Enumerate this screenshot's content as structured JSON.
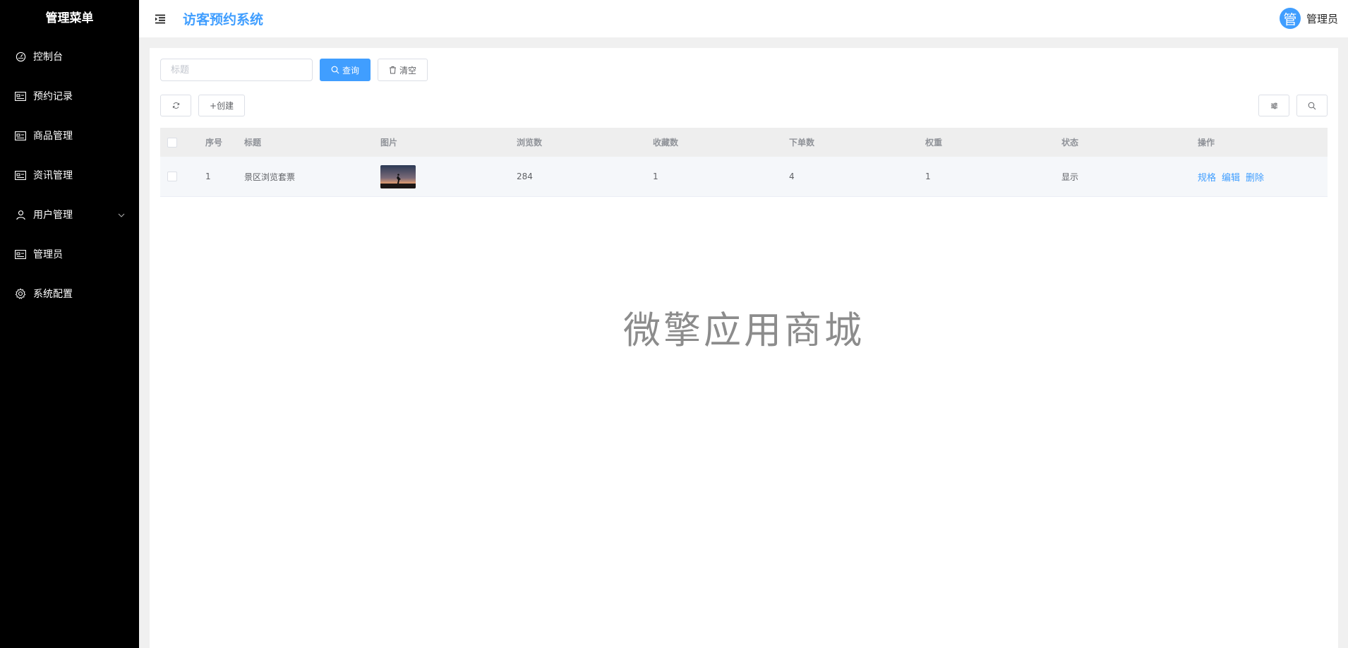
{
  "sidebar": {
    "title": "管理菜单",
    "items": [
      {
        "label": "控制台",
        "icon": "dashboard-icon"
      },
      {
        "label": "预约记录",
        "icon": "card-icon"
      },
      {
        "label": "商品管理",
        "icon": "card-icon"
      },
      {
        "label": "资讯管理",
        "icon": "card-icon"
      },
      {
        "label": "用户管理",
        "icon": "user-icon",
        "expandable": true
      },
      {
        "label": "管理员",
        "icon": "card-icon"
      },
      {
        "label": "系统配置",
        "icon": "gear-icon"
      }
    ]
  },
  "header": {
    "title": "访客预约系统",
    "avatar_text": "管",
    "user_name": "管理员"
  },
  "search": {
    "placeholder": "标题",
    "query_label": "查询",
    "clear_label": "清空"
  },
  "toolbar": {
    "create_label": "+创建"
  },
  "table": {
    "headers": {
      "idx": "序号",
      "title": "标题",
      "image": "图片",
      "views": "浏览数",
      "favs": "收藏数",
      "orders": "下单数",
      "weight": "权重",
      "status": "状态",
      "ops": "操作"
    },
    "rows": [
      {
        "idx": "1",
        "title": "景区浏览套票",
        "views": "284",
        "favs": "1",
        "orders": "4",
        "weight": "1",
        "status": "显示",
        "ops": [
          "规格",
          "编辑",
          "删除"
        ]
      }
    ]
  },
  "watermark": "微擎应用商城",
  "colors": {
    "accent": "#409eff",
    "sidebar_bg": "#000000"
  }
}
